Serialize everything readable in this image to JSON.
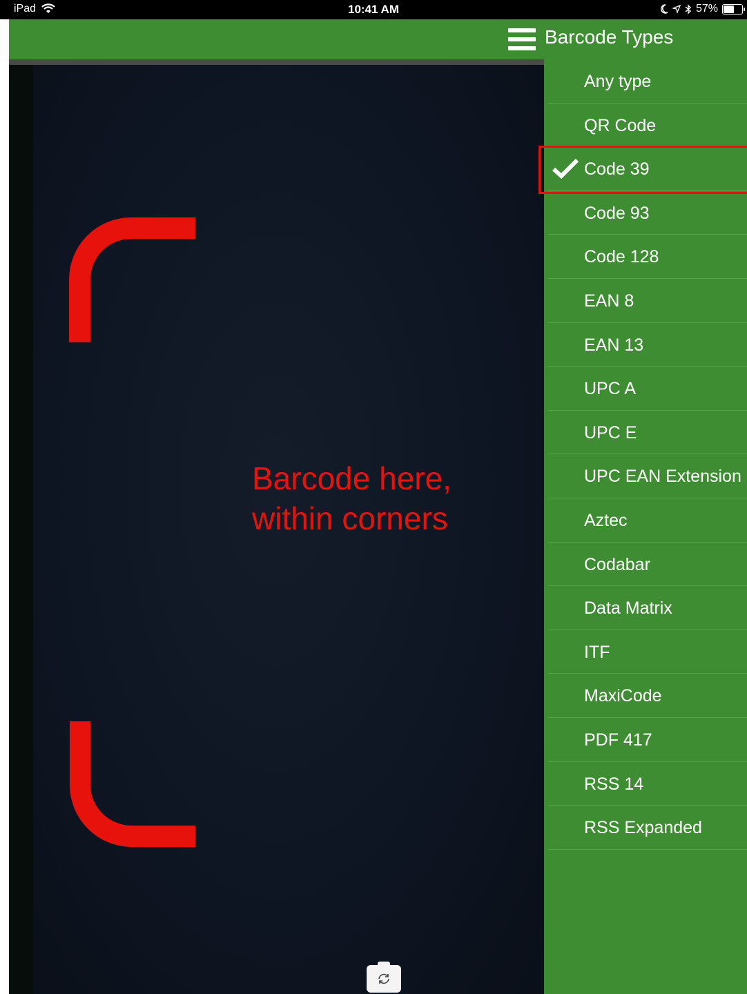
{
  "status_bar": {
    "device": "iPad",
    "time": "10:41 AM",
    "battery_text": "57%",
    "battery_level": 0.57
  },
  "header": {
    "menu_icon": "hamburger-icon",
    "title": "Barcode Types"
  },
  "scanner": {
    "hint_line1": "Barcode here,",
    "hint_line2": "within corners",
    "accent_color": "#e8120c",
    "switch_camera_icon": "camera-switch-icon"
  },
  "barcode_types": {
    "selected": "Code 39",
    "items": [
      {
        "label": "Any type"
      },
      {
        "label": "QR Code"
      },
      {
        "label": "Code 39"
      },
      {
        "label": "Code 93"
      },
      {
        "label": "Code 128"
      },
      {
        "label": "EAN 8"
      },
      {
        "label": "EAN 13"
      },
      {
        "label": "UPC A"
      },
      {
        "label": "UPC E"
      },
      {
        "label": "UPC EAN Extension"
      },
      {
        "label": "Aztec"
      },
      {
        "label": "Codabar"
      },
      {
        "label": "Data Matrix"
      },
      {
        "label": "ITF"
      },
      {
        "label": "MaxiCode"
      },
      {
        "label": "PDF 417"
      },
      {
        "label": "RSS 14"
      },
      {
        "label": "RSS Expanded"
      }
    ]
  },
  "colors": {
    "panel_green": "#3f8d33",
    "highlight_red": "#e8120c"
  }
}
